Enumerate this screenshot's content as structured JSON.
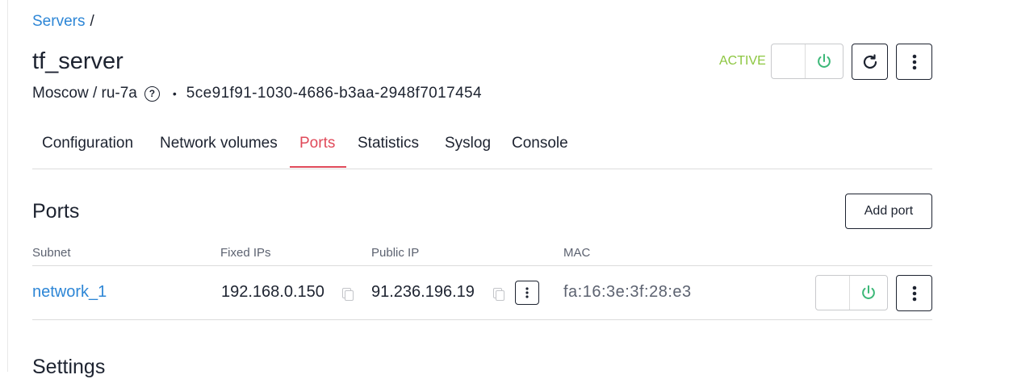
{
  "breadcrumb": {
    "link": "Servers",
    "separator": "/"
  },
  "server": {
    "name": "tf_server",
    "region": "Moscow / ru-7a",
    "help_glyph": "?",
    "bullet": "•",
    "uuid": "5ce91f91-1030-4686-b3aa-2948f7017454",
    "status": "ACTIVE",
    "status_color": "#8cc63f"
  },
  "tabs": [
    "Configuration",
    "Network volumes",
    "Ports",
    "Statistics",
    "Syslog",
    "Console"
  ],
  "active_tab": "Ports",
  "ports": {
    "heading": "Ports",
    "add_label": "Add port",
    "columns": [
      "Subnet",
      "Fixed IPs",
      "Public IP",
      "MAC"
    ],
    "rows": [
      {
        "subnet": "network_1",
        "fixed_ip": "192.168.0.150",
        "public_ip": "91.236.196.19",
        "mac": "fa:16:3e:3f:28:e3"
      }
    ]
  },
  "settings_heading": "Settings",
  "icons": [
    "power-icon",
    "refresh-icon",
    "more-vertical-icon",
    "copy-icon",
    "help-icon"
  ],
  "colors": {
    "link": "#2d86d6",
    "active_tab": "#e04a5a",
    "power": "#3cb878"
  }
}
